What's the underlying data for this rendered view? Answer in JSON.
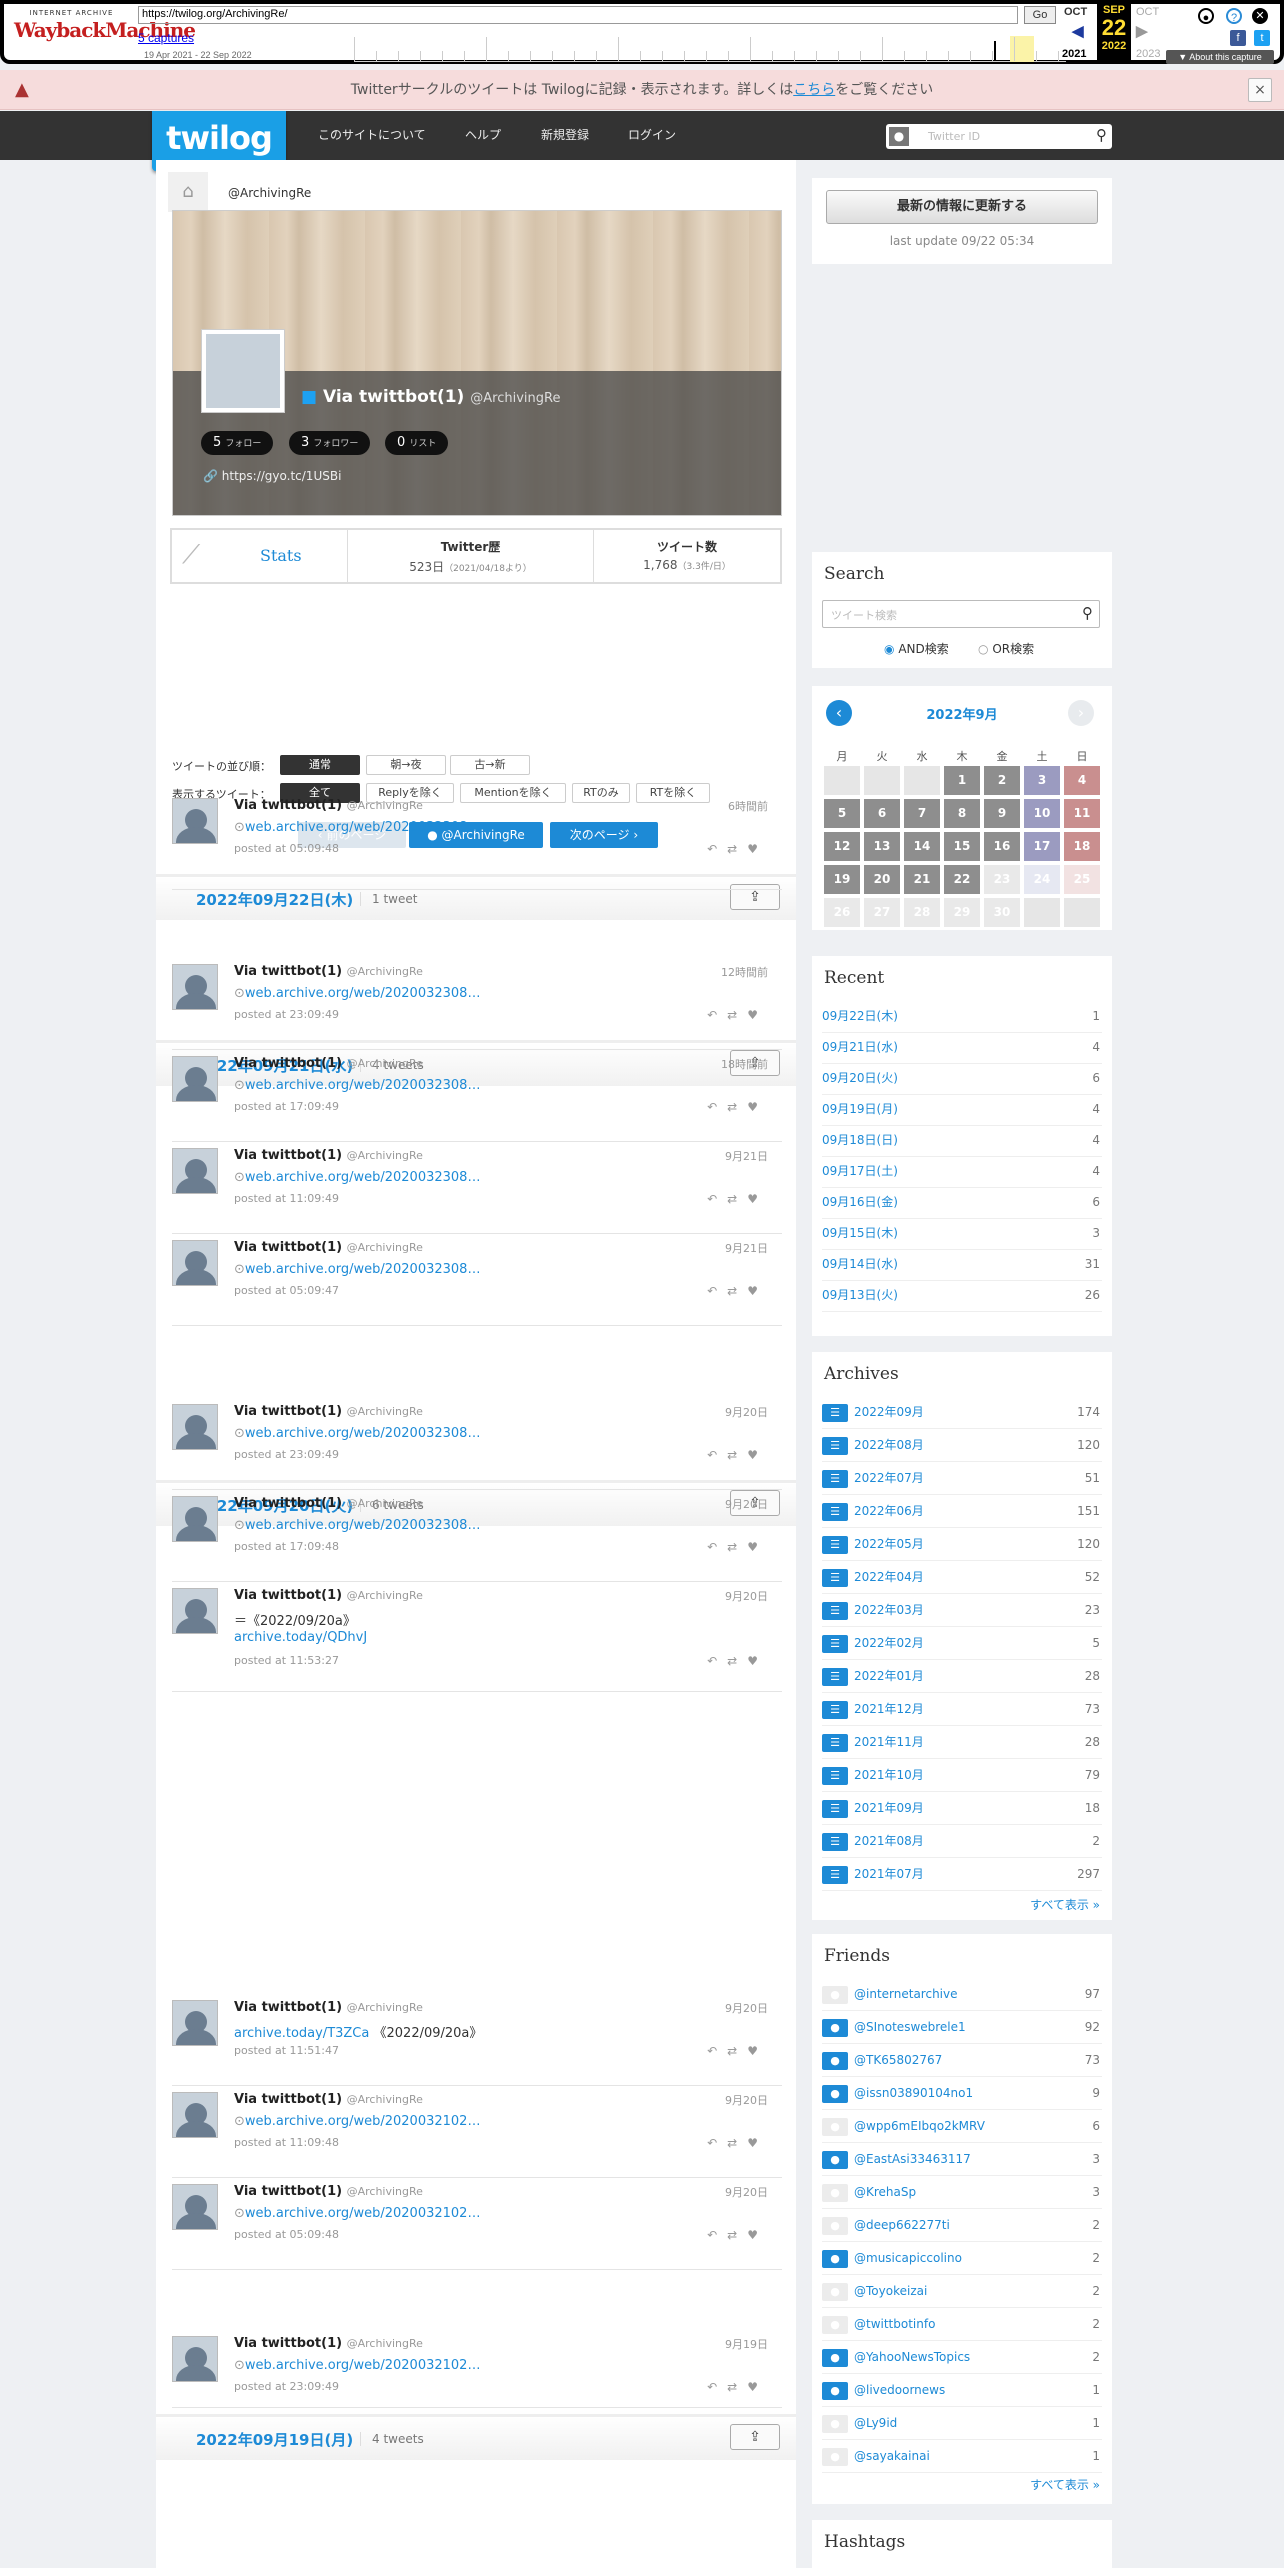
{
  "wayback": {
    "url": "https://twilog.org/ArchivingRe/",
    "go": "Go",
    "captures": "5 captures",
    "range": "19 Apr 2021 - 22 Sep 2022",
    "prev_month": "OCT",
    "prev_year": "2021",
    "cur_month": "SEP",
    "cur_day": "22",
    "cur_year": "2022",
    "next_month": "OCT",
    "next_year": "2023",
    "about": "About this capture"
  },
  "notice": {
    "text": "Twitterサークルのツイートは Twilogに記録・表示されます。詳しくは",
    "link": "こちら",
    "tail": "をご覧ください",
    "close": "×"
  },
  "header": {
    "logo": "twilog",
    "nav": [
      "このサイトについて",
      "ヘルプ",
      "新規登録",
      "ログイン"
    ],
    "search_placeholder": "Twitter ID"
  },
  "profile": {
    "crumb": "@ArchivingRe",
    "name": "Via twittbot(1)",
    "screen_name": "@ArchivingRe",
    "follow_n": "5",
    "follow_l": "フォロー",
    "follower_n": "3",
    "follower_l": "フォロワー",
    "list_n": "0",
    "list_l": "リスト",
    "link": "https://gyo.tc/1USBi"
  },
  "stats": {
    "title": "Stats",
    "hist_h": "Twitter歴",
    "hist_v": "523日",
    "hist_s": "（2021/04/18より）",
    "count_h": "ツイート数",
    "count_v": "1,768",
    "count_s": "（3.3件/日）"
  },
  "controls": {
    "order_label": "ツイートの並び順：",
    "order": [
      "通常",
      "朝→夜",
      "古→新"
    ],
    "show_label": "表示するツイート：",
    "show": [
      "全て",
      "Replyを除く",
      "Mentionを除く",
      "RTのみ",
      "RTを除く"
    ],
    "prev": "前のページ",
    "user": "@ArchivingRe",
    "next": "次のページ"
  },
  "days": [
    {
      "date": "2022年09月22日(木)",
      "count": "1 tweet"
    },
    {
      "date": "2022年09月21日(水)",
      "count": "4 tweets"
    },
    {
      "date": "2022年09月20日(火)",
      "count": "6 tweets"
    },
    {
      "date": "2022年09月19日(月)",
      "count": "4 tweets"
    }
  ],
  "tweets": [
    {
      "name": "Via twittbot(1)",
      "sn": "@ArchivingRe",
      "time": "6時間前",
      "body": "web.archive.org/web/2020032308…",
      "posted": "posted at 05:09:48"
    },
    {
      "name": "Via twittbot(1)",
      "sn": "@ArchivingRe",
      "time": "12時間前",
      "body": "web.archive.org/web/2020032308…",
      "posted": "posted at 23:09:49"
    },
    {
      "name": "Via twittbot(1)",
      "sn": "@ArchivingRe",
      "time": "18時間前",
      "body": "web.archive.org/web/2020032308…",
      "posted": "posted at 17:09:49"
    },
    {
      "name": "Via twittbot(1)",
      "sn": "@ArchivingRe",
      "time": "9月21日",
      "body": "web.archive.org/web/2020032308…",
      "posted": "posted at 11:09:49"
    },
    {
      "name": "Via twittbot(1)",
      "sn": "@ArchivingRe",
      "time": "9月21日",
      "body": "web.archive.org/web/2020032308…",
      "posted": "posted at 05:09:47"
    },
    {
      "name": "Via twittbot(1)",
      "sn": "@ArchivingRe",
      "time": "9月20日",
      "body": "web.archive.org/web/2020032308…",
      "posted": "posted at 23:09:49"
    },
    {
      "name": "Via twittbot(1)",
      "sn": "@ArchivingRe",
      "time": "9月20日",
      "body": "web.archive.org/web/2020032308…",
      "posted": "posted at 17:09:48"
    },
    {
      "name": "Via twittbot(1)",
      "sn": "@ArchivingRe",
      "time": "9月20日",
      "line1": "＝《2022/09/20a》",
      "line2": "archive.today/QDhvJ",
      "posted": "posted at 11:53:27"
    },
    {
      "name": "Via twittbot(1)",
      "sn": "@ArchivingRe",
      "time": "9月20日",
      "body": "archive.today/T3ZCa",
      "tail": "《2022/09/20a》",
      "posted": "posted at 11:51:47"
    },
    {
      "name": "Via twittbot(1)",
      "sn": "@ArchivingRe",
      "time": "9月20日",
      "body": "web.archive.org/web/2020032102…",
      "posted": "posted at 11:09:48"
    },
    {
      "name": "Via twittbot(1)",
      "sn": "@ArchivingRe",
      "time": "9月20日",
      "body": "web.archive.org/web/2020032102…",
      "posted": "posted at 05:09:48"
    },
    {
      "name": "Via twittbot(1)",
      "sn": "@ArchivingRe",
      "time": "9月19日",
      "body": "web.archive.org/web/2020032102…",
      "posted": "posted at 23:09:49"
    }
  ],
  "sidebar": {
    "update_btn": "最新の情報に更新する",
    "last_update": "last update 09/22 05:34",
    "search_title": "Search",
    "search_ph": "ツイート検索",
    "and": "AND検索",
    "or": "OR検索",
    "cal_title": "2022年9月",
    "weekdays": [
      "月",
      "火",
      "水",
      "木",
      "金",
      "土",
      "日"
    ],
    "cal": [
      "",
      "",
      "",
      "1",
      "2",
      "3",
      "4",
      "5",
      "6",
      "7",
      "8",
      "9",
      "10",
      "11",
      "12",
      "13",
      "14",
      "15",
      "16",
      "17",
      "18",
      "19",
      "20",
      "21",
      "22",
      "23",
      "24",
      "25",
      "26",
      "27",
      "28",
      "29",
      "30",
      "",
      ""
    ],
    "recent_title": "Recent",
    "recent": [
      [
        "09月22日(木)",
        "1"
      ],
      [
        "09月21日(水)",
        "4"
      ],
      [
        "09月20日(火)",
        "6"
      ],
      [
        "09月19日(月)",
        "4"
      ],
      [
        "09月18日(日)",
        "4"
      ],
      [
        "09月17日(土)",
        "4"
      ],
      [
        "09月16日(金)",
        "6"
      ],
      [
        "09月15日(木)",
        "3"
      ],
      [
        "09月14日(水)",
        "31"
      ],
      [
        "09月13日(火)",
        "26"
      ]
    ],
    "archives_title": "Archives",
    "archives": [
      [
        "2022年09月",
        "174"
      ],
      [
        "2022年08月",
        "120"
      ],
      [
        "2022年07月",
        "51"
      ],
      [
        "2022年06月",
        "151"
      ],
      [
        "2022年05月",
        "120"
      ],
      [
        "2022年04月",
        "52"
      ],
      [
        "2022年03月",
        "23"
      ],
      [
        "2022年02月",
        "5"
      ],
      [
        "2022年01月",
        "28"
      ],
      [
        "2021年12月",
        "73"
      ],
      [
        "2021年11月",
        "28"
      ],
      [
        "2021年10月",
        "79"
      ],
      [
        "2021年09月",
        "18"
      ],
      [
        "2021年08月",
        "2"
      ],
      [
        "2021年07月",
        "297"
      ]
    ],
    "more": "すべて表示 »",
    "friends_title": "Friends",
    "friends": [
      [
        "@internetarchive",
        "97"
      ],
      [
        "@SInoteswebrele1",
        "92"
      ],
      [
        "@TK65802767",
        "73"
      ],
      [
        "@issn03890104no1",
        "9"
      ],
      [
        "@wpp6mEIbqo2kMRV",
        "6"
      ],
      [
        "@EastAsi33463117",
        "3"
      ],
      [
        "@KrehaSp",
        "3"
      ],
      [
        "@deep662277ti",
        "2"
      ],
      [
        "@musicapiccolino",
        "2"
      ],
      [
        "@Toyokeizai",
        "2"
      ],
      [
        "@twittbotinfo",
        "2"
      ],
      [
        "@YahooNewsTopics",
        "2"
      ],
      [
        "@livedoornews",
        "1"
      ],
      [
        "@Ly9id",
        "1"
      ],
      [
        "@sayakainai",
        "1"
      ]
    ],
    "hashtags_title": "Hashtags"
  }
}
